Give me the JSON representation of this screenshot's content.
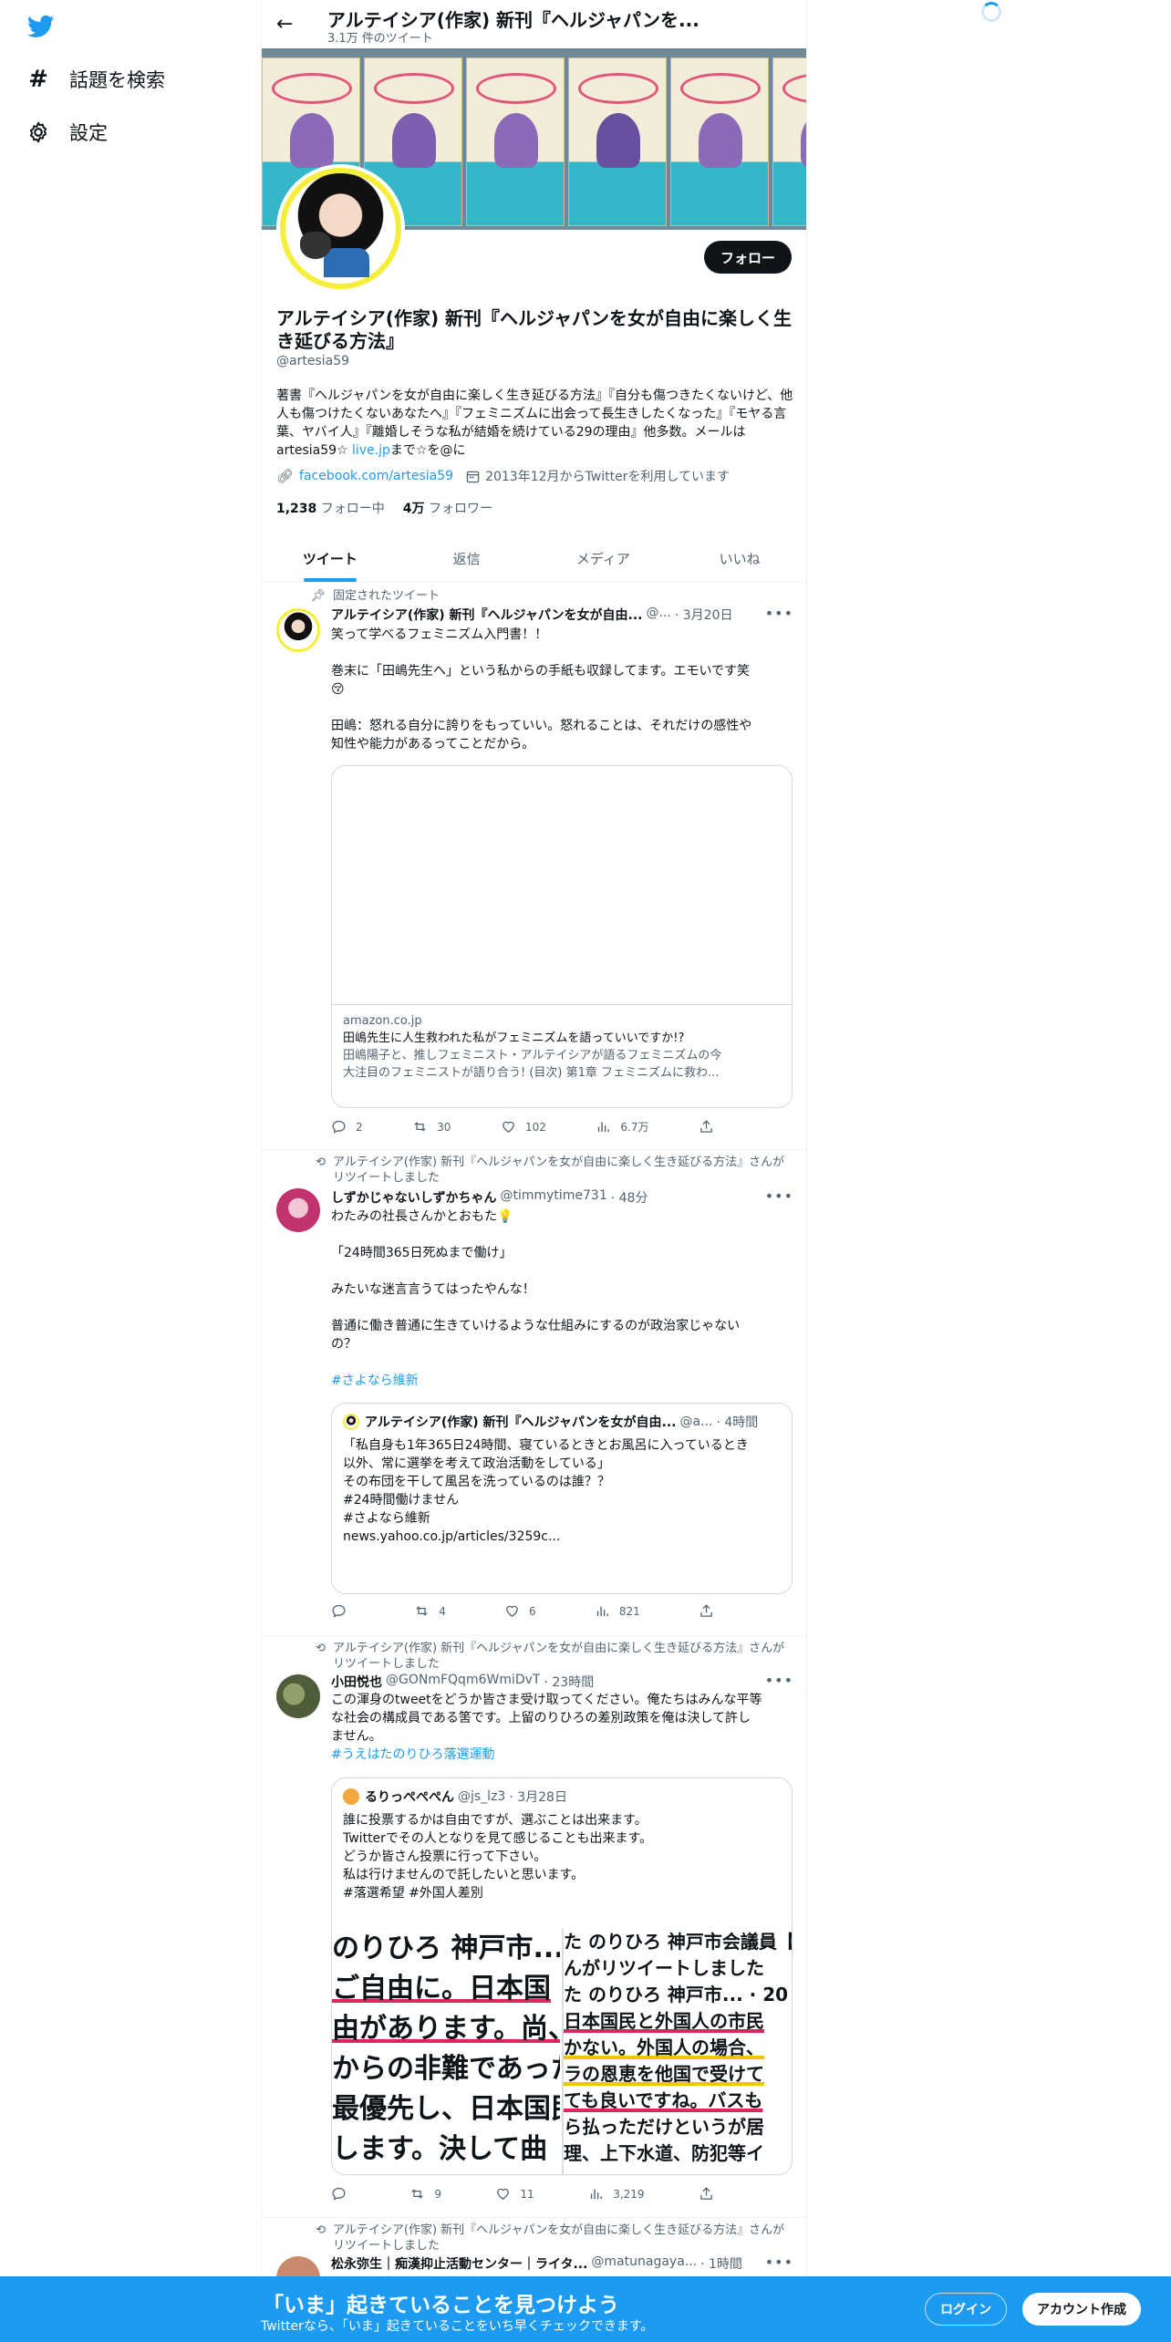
{
  "nav": {
    "explore_label": "話題を検索",
    "settings_label": "設定"
  },
  "header": {
    "name": "アルテイシア(作家) 新刊『ヘルジャパンを...",
    "tweet_count": "3.1万 件のツイート"
  },
  "profile": {
    "follow_label": "フォロー",
    "name": "アルテイシア(作家) 新刊『ヘルジャパンを女が自由に楽しく生き延びる方法』",
    "handle": "@artesia59",
    "bio_before_link": "著書『ヘルジャパンを女が自由に楽しく生き延びる方法』『自分も傷つきたくないけど、他人も傷つけたくないあなたへ』『フェミニズムに出会って長生きしたくなった』『モヤる言葉、ヤバイ人』『離婚しそうな私が結婚を続けている29の理由』他多数。メールはartesia59☆ ",
    "bio_link": "live.jp",
    "bio_after_link": "まで☆を@に",
    "website": "facebook.com/artesia59",
    "joined": "2013年12月からTwitterを利用しています",
    "following_count": "1,238",
    "following_label": "フォロー中",
    "followers_count": "4万",
    "followers_label": "フォロワー"
  },
  "tabs": [
    "ツイート",
    "返信",
    "メディア",
    "いいね"
  ],
  "tweets": [
    {
      "context": "固定されたツイート",
      "name": "アルテイシア(作家) 新刊『ヘルジャパンを女が自由...",
      "handle": "@...",
      "time": "· 3月20日",
      "lines": [
        "笑って学べるフェミニズム入門書！！",
        "",
        "巻末に「田嶋先生へ」という私からの手紙も収録してます。エモいです笑",
        "😚",
        "",
        "田嶋：怒れる自分に誇りをもっていい。怒れることは、それだけの感性や",
        "知性や能力があるってことだから。"
      ],
      "card": {
        "domain": "amazon.co.jp",
        "title": "田嶋先生に人生救われた私がフェミニズムを語っていいですか!?",
        "desc1": "田嶋陽子と、推しフェミニスト・アルテイシアが語るフェミニズムの今",
        "desc2": "大注目のフェミニストが語り合う! (目次) 第1章 フェミニズムに救わ..."
      },
      "replies": "2",
      "retweets": "30",
      "likes": "102",
      "views": "6.7万"
    },
    {
      "context": "アルテイシア(作家) 新刊『ヘルジャパンを女が自由に楽しく生き延びる方法』さんがリツイートしました",
      "name": "しずかじゃないしずかちゃん",
      "handle": "@timmytime731",
      "time": "· 48分",
      "lines": [
        "わたみの社長さんかとおもた💡",
        "",
        "「24時間365日死ぬまで働け」",
        "",
        "みたいな迷言言うてはったやんな！",
        "",
        "普通に働き普通に生きていけるような仕組みにするのが政治家じゃない",
        "の？",
        "",
        "#さよなら維新"
      ],
      "quote": {
        "name": "アルテイシア(作家) 新刊『ヘルジャパンを女が自由...",
        "handle": "@a...",
        "time": "· 4時間",
        "lines": [
          "「私自身も1年365日24時間、寝ているときとお風呂に入っているとき",
          "以外、常に選挙を考えて政治活動をしている」",
          "",
          "その布団を干して風呂を洗っているのは誰？？",
          "",
          "#24時間働けません",
          "#さよなら維新",
          "news.yahoo.co.jp/articles/3259c..."
        ]
      },
      "replies": "",
      "retweets": "4",
      "likes": "6",
      "views": "821"
    },
    {
      "context": "アルテイシア(作家) 新刊『ヘルジャパンを女が自由に楽しく生き延びる方法』さんがリツイートしました",
      "name": "小田悦也",
      "handle": "@GONmFQqm6WmiDvT",
      "time": "· 23時間",
      "lines": [
        "この渾身のtweetをどうか皆さま受け取ってください。俺たちはみんな平等",
        "な社会の構成員である筈です。上留のりひろの差別政策を俺は決して許し",
        "ません。",
        "#うえはたのりひろ落選運動"
      ],
      "quote": {
        "name": "るりっぺぺぺん",
        "handle": "@js_lz3",
        "time": "· 3月28日",
        "lines": [
          "誰に投票するかは自由ですが、選ぶことは出来ます。",
          "Twitterでその人となりを見て感じることも出来ます。",
          "どうか皆さん投票に行って下さい。",
          "私は行けませんので託したいと思います。",
          "#落選希望 #外国人差別"
        ],
        "img_left": [
          "のりひろ 神戸市...",
          "ご自由に。日本国",
          "由があります。尚、",
          "からの非難であった",
          "最優先し、日本国民",
          "します。決して曲"
        ],
        "img_right": [
          "た のりひろ 神戸市会議員【東",
          "んがリツイートしました",
          "た のりひろ 神戸市... · 20",
          "日本国民と外国人の市民",
          "かない。外国人の場合、",
          "ラの恩恵を他国で受けて",
          "ても良いですね。バスも",
          "ら払っただけというが居",
          "理、上下水道、防犯等イ"
        ]
      },
      "replies": "",
      "retweets": "9",
      "likes": "11",
      "views": "3,219"
    },
    {
      "context": "アルテイシア(作家) 新刊『ヘルジャパンを女が自由に楽しく生き延びる方法』さんがリツイートしました",
      "name": "松永弥生｜痴漢抑止活動センター｜ライタ...",
      "handle": "@matunagaya...",
      "time": "· 1時間"
    }
  ],
  "bottom_bar": {
    "title": "「いま」起きていることを見つけよう",
    "subtitle": "Twitterなら、「いま」起きていることをいち早くチェックできます。",
    "login": "ログイン",
    "signup": "アカウント作成"
  }
}
